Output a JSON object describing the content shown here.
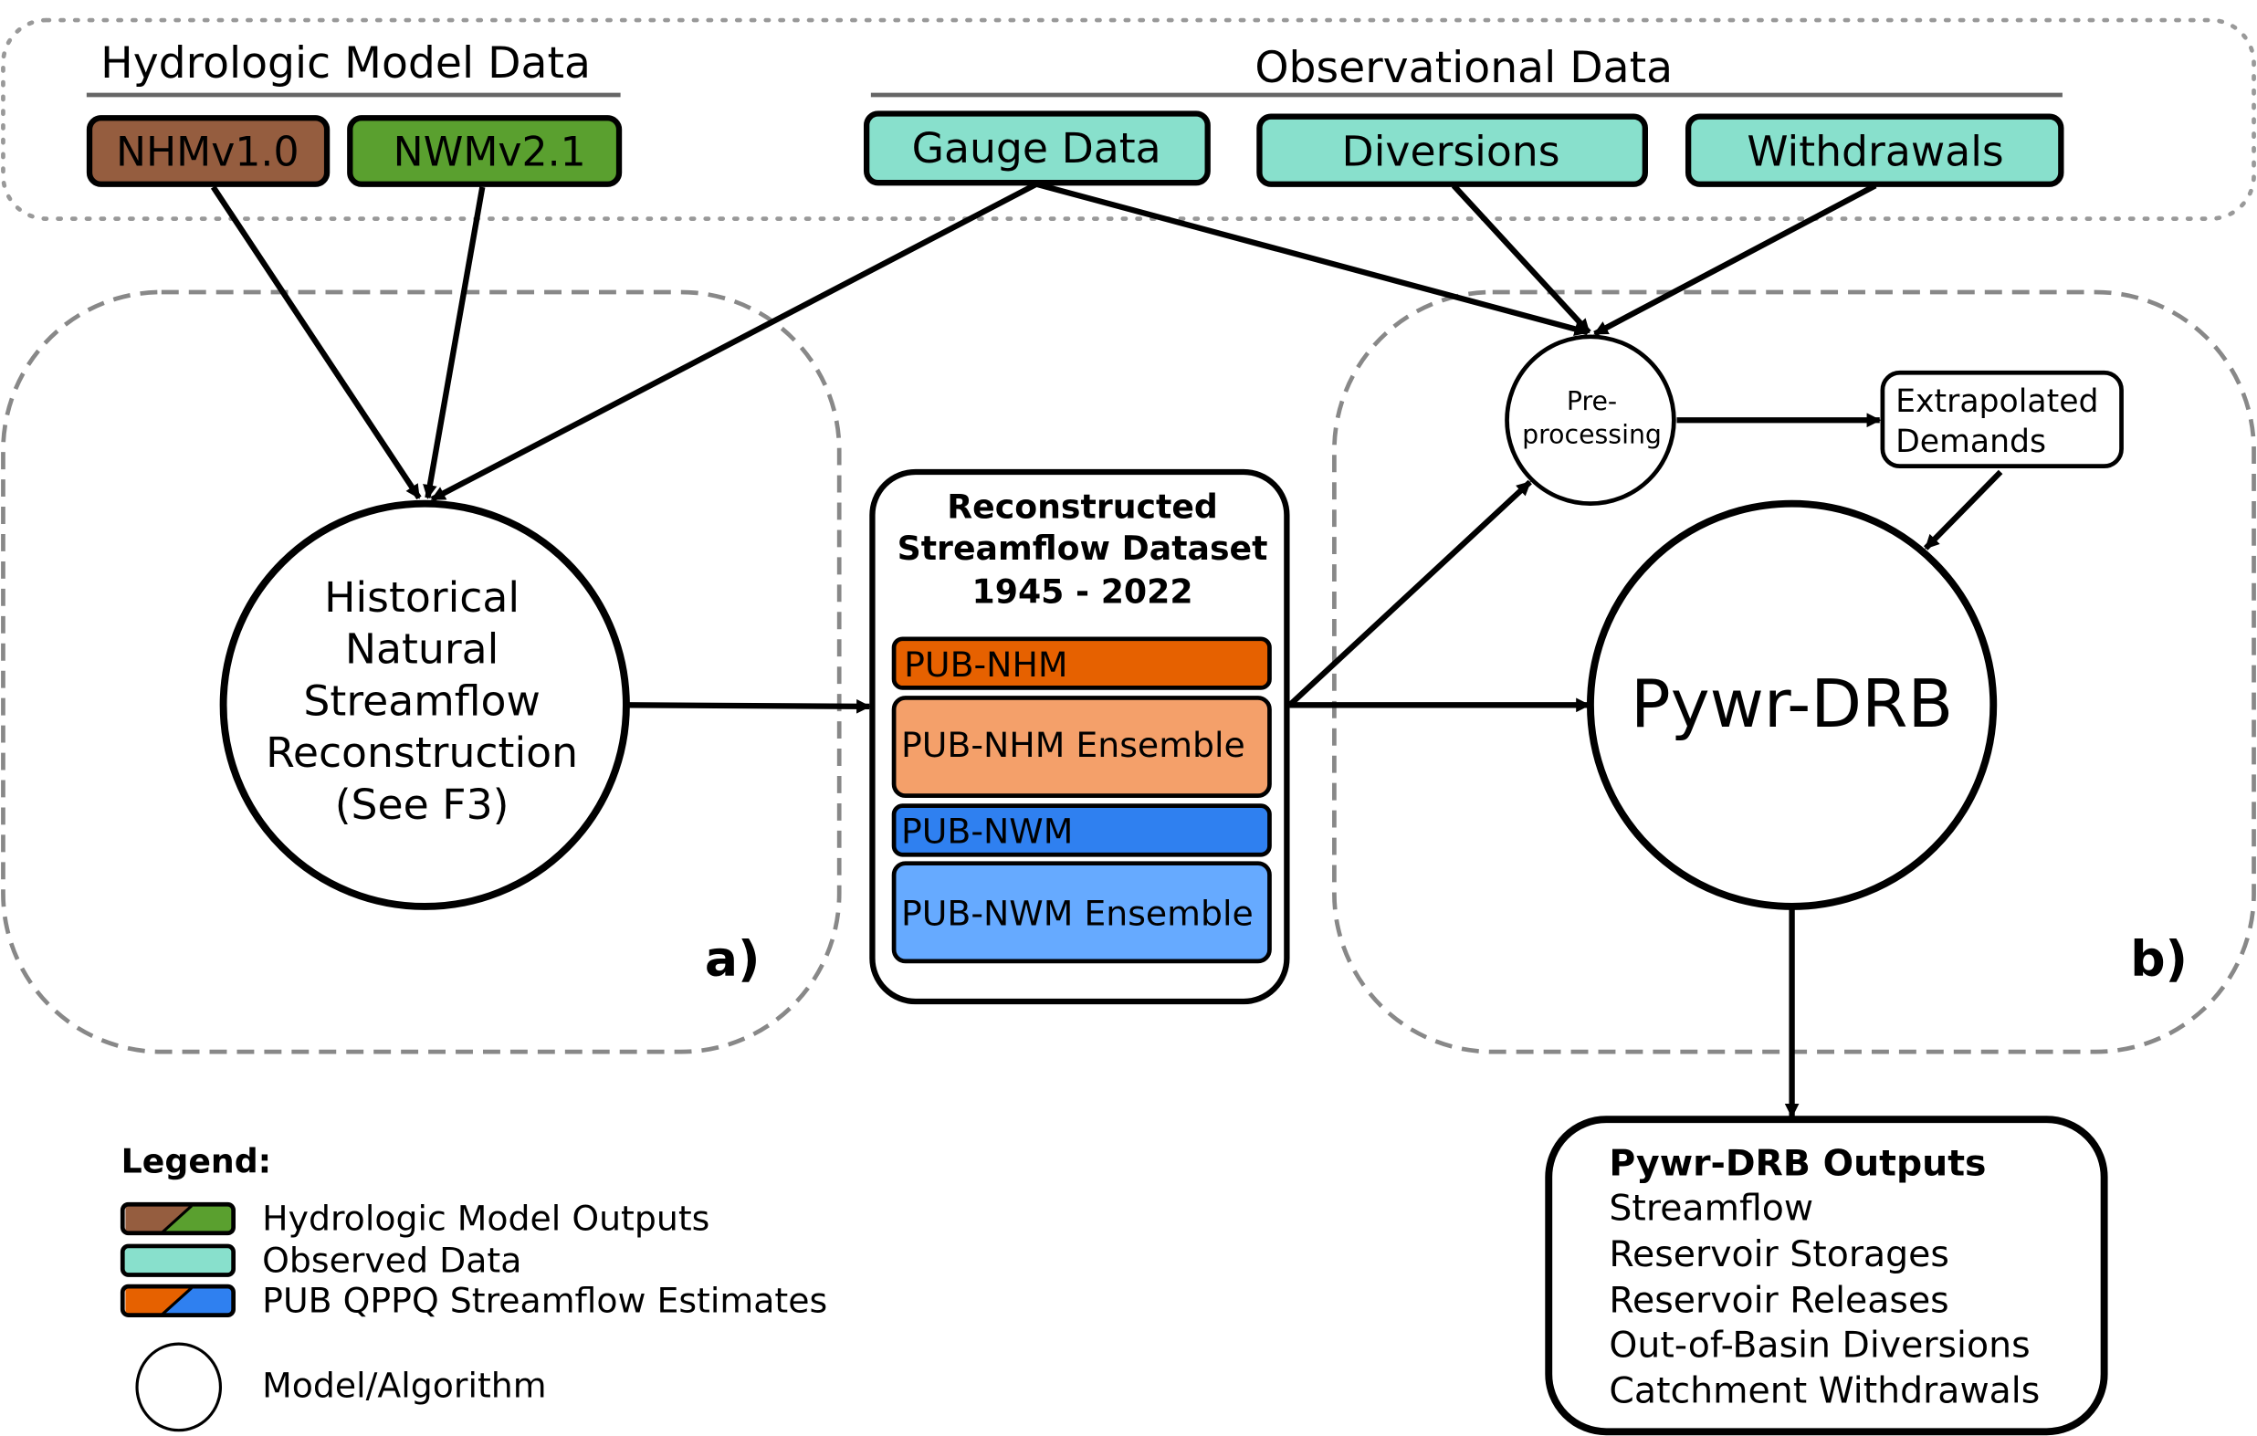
{
  "hydrologic_model_data": {
    "title": "Hydrologic Model Data",
    "items": [
      {
        "label": "NHMv1.0",
        "color": "#955d3f"
      },
      {
        "label": "NWMv2.1",
        "color": "#5aa02f"
      }
    ]
  },
  "observational_data": {
    "title": "Observational Data",
    "color": "#88e0cc",
    "items": [
      {
        "label": "Gauge Data"
      },
      {
        "label": "Diversions"
      },
      {
        "label": "Withdrawals"
      }
    ]
  },
  "panel_a": {
    "label": "a)",
    "node_lines": [
      "Historical",
      "Natural",
      "Streamflow",
      "Reconstruction",
      "(See F3)"
    ]
  },
  "dataset": {
    "title_lines": [
      "Reconstructed",
      "Streamflow Dataset",
      "1945 - 2022"
    ],
    "items": [
      {
        "label": "PUB-NHM",
        "color": "#e66100"
      },
      {
        "label": "PUB-NHM Ensemble",
        "color": "#f4a06a"
      },
      {
        "label": "PUB-NWM",
        "color": "#2f80f0"
      },
      {
        "label": "PUB-NWM Ensemble",
        "color": "#66aaff"
      }
    ]
  },
  "panel_b": {
    "label": "b)",
    "preprocessing_lines": [
      "Pre-",
      "processing"
    ],
    "extrapolated_lines": [
      "Extrapolated",
      "Demands"
    ],
    "model": "Pywr-DRB"
  },
  "outputs": {
    "title": "Pywr-DRB Outputs",
    "items": [
      "Streamflow",
      "Reservoir Storages",
      "Reservoir Releases",
      "Out-of-Basin Diversions",
      "Catchment Withdrawals"
    ]
  },
  "legend": {
    "title": "Legend:",
    "items": [
      {
        "label": "Hydrologic Model Outputs"
      },
      {
        "label": "Observed Data"
      },
      {
        "label": "PUB QPPQ Streamflow Estimates"
      },
      {
        "label": "Model/Algorithm"
      }
    ]
  }
}
